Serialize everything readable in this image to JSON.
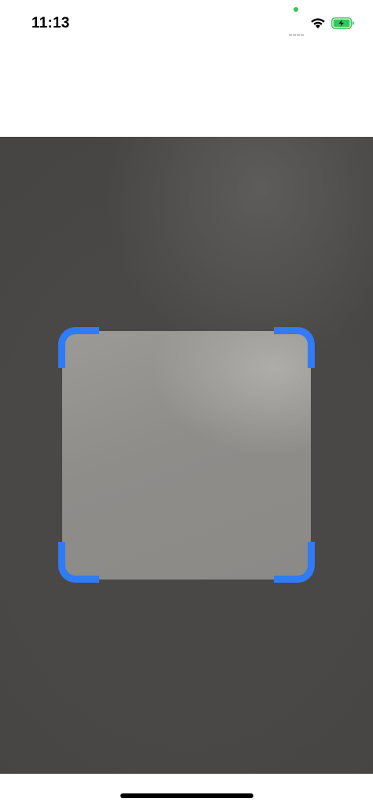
{
  "status_bar": {
    "time": "11:13",
    "privacy_indicator_color": "#34c759",
    "icons": [
      "cellular-icon",
      "wifi-icon",
      "battery-charging-icon"
    ]
  },
  "scanner": {
    "frame_color": "#2f7cf6",
    "corner_markers": [
      "top-left",
      "top-right",
      "bottom-left",
      "bottom-right"
    ]
  }
}
